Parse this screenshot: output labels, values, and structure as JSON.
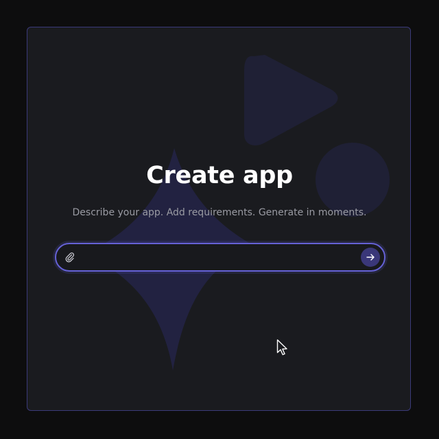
{
  "creator": {
    "title": "Create app",
    "subtitle": "Describe your app. Add requirements. Generate in moments.",
    "prompt_input": {
      "value": "",
      "placeholder": ""
    },
    "attach_icon": "paperclip-icon",
    "send_icon": "arrow-right-icon"
  },
  "colors": {
    "page_background": "#0d0d0e",
    "panel_background": "#1a1b1f",
    "accent": "#6561d6",
    "send_button": "#3a3779",
    "text_primary": "#ffffff",
    "text_secondary": "#9a9ba3"
  }
}
